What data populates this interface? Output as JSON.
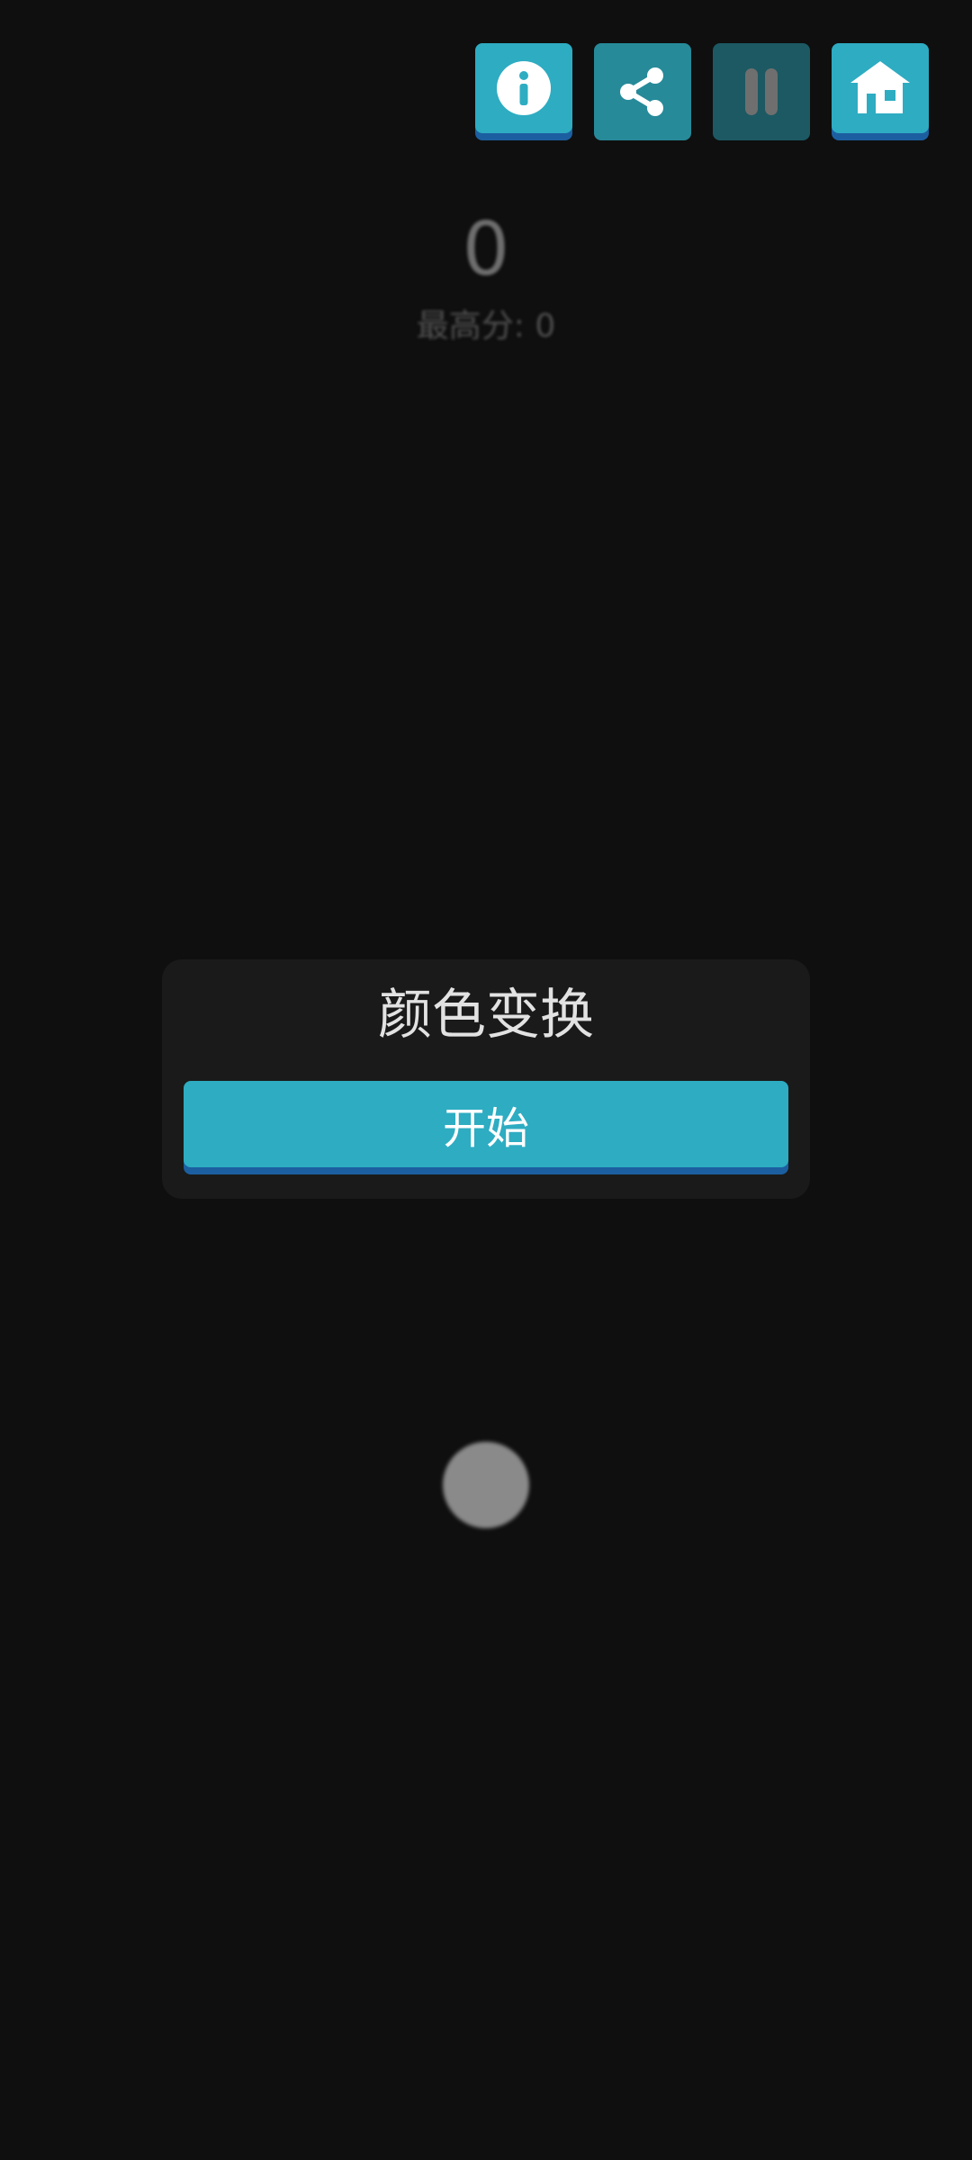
{
  "toolbar": {
    "buttons": [
      {
        "id": "info",
        "icon": "info-icon"
      },
      {
        "id": "share",
        "icon": "share-icon"
      },
      {
        "id": "pause",
        "icon": "pause-icon"
      },
      {
        "id": "home",
        "icon": "home-icon"
      }
    ]
  },
  "score": {
    "current": "0",
    "best_label": "最高分: 0"
  },
  "dialog": {
    "title": "颜色变换",
    "start_label": "开始"
  },
  "colors": {
    "background": "#0f0f0f",
    "accent": "#2eacc2",
    "accent_shadow": "#1c5fa0",
    "dialog_bg": "#1a1a1a"
  }
}
